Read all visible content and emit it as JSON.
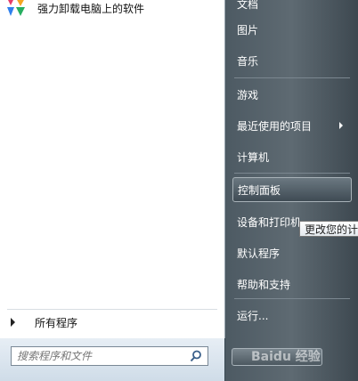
{
  "left_pane": {
    "apps": [
      {
        "label": "强力卸载电脑上的软件",
        "icon": "app-logo-icon"
      }
    ],
    "all_programs_label": "所有程序"
  },
  "search": {
    "placeholder": "搜索程序和文件"
  },
  "right_pane": {
    "items": [
      {
        "label": "文档",
        "submenu": false
      },
      {
        "label": "图片",
        "submenu": false
      },
      {
        "label": "音乐",
        "submenu": false
      },
      {
        "label": "游戏",
        "submenu": false
      },
      {
        "label": "最近使用的项目",
        "submenu": true
      },
      {
        "label": "计算机",
        "submenu": false
      },
      {
        "label": "控制面板",
        "submenu": false,
        "highlighted": true
      },
      {
        "label": "设备和打印机",
        "submenu": false
      },
      {
        "label": "默认程序",
        "submenu": false
      },
      {
        "label": "帮助和支持",
        "submenu": false
      },
      {
        "label": "运行...",
        "submenu": false
      }
    ]
  },
  "tooltip": {
    "text": "更改您的计"
  },
  "watermark": {
    "text": "Baidu 经验"
  },
  "colors": {
    "right_pane_bg": "#55626b",
    "left_pane_bg": "#ffffff",
    "highlight_border": "#a8b2b8"
  }
}
